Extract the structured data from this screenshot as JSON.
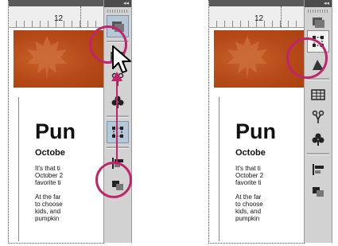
{
  "toolbar_header_glyph": "◂◂",
  "ruler_number": "12",
  "document": {
    "headline": "Pun",
    "subhead": "Octobe",
    "para1": [
      "It's that ti",
      "October 2",
      "favorite ti"
    ],
    "para2": [
      "At the far",
      "to choose",
      "kids, and",
      "pumpkin"
    ]
  },
  "colors": {
    "accent": "#c0246a",
    "hero": "#b54a18"
  },
  "left_panel": {
    "toolbar_icons": [
      "command-bar-icon",
      "columns-icon",
      "scissors-icon",
      "club-icon",
      "transform-icon",
      "align-icon",
      "arrange-icon"
    ],
    "highlighted": [
      "command-bar-icon",
      "transform-icon"
    ],
    "pointer": "arrow-cursor-icon"
  },
  "right_panel": {
    "toolbar_icons": [
      "command-bar-icon",
      "transform-icon",
      "gradient-icon",
      "table-icon",
      "scissors-icon",
      "club-icon",
      "align-icon",
      "arrange-icon"
    ],
    "highlighted": [
      "transform-icon"
    ]
  }
}
